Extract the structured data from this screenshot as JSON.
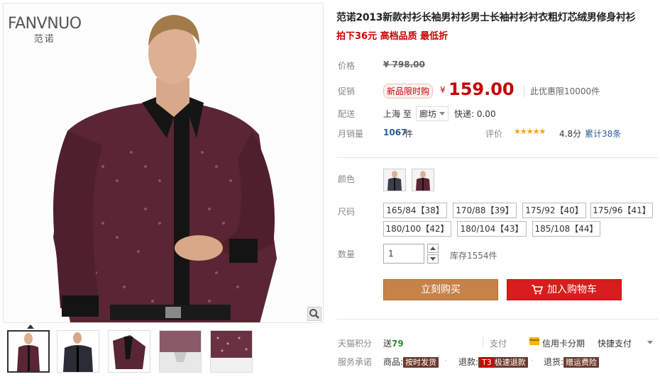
{
  "brand": {
    "logo": "FANVNUO",
    "logo_sub": "范诺"
  },
  "gallery": {
    "zoom_icon": "magnifier-icon",
    "thumb_count": 5
  },
  "product": {
    "title": "范诺2013新款衬衫长袖男衬衫男士长袖衬衫衬衣粗灯芯绒男修身衬衫",
    "subtitle": "拍下36元 高档品质 最低折"
  },
  "price": {
    "orig_label": "价格",
    "orig_value": "¥ 798.00",
    "promo_label": "促销",
    "promo_badge": "新品限时购",
    "promo_yen": "¥",
    "promo_value": "159.00",
    "promo_note": "此优惠限10000件"
  },
  "shipping": {
    "label": "配送",
    "from": "上海 至",
    "to": "廊坊",
    "express": "快递: 0.00"
  },
  "sales": {
    "label": "月销量",
    "value": "1067",
    "unit": "件",
    "rating_label": "评价",
    "stars": "★★★★★",
    "score": "4.8分",
    "reviews": "累计38条"
  },
  "options": {
    "color_label": "颜色",
    "size_label": "尺码",
    "sizes": [
      "165/84【38】",
      "170/88【39】",
      "175/92【40】",
      "175/96【41】",
      "180/100【42】",
      "180/104【43】",
      "185/108【44】"
    ],
    "qty_label": "数量",
    "qty_value": "1",
    "stock": "库存1554件"
  },
  "actions": {
    "buy_now": "立刻购买",
    "add_cart": "加入购物车"
  },
  "footer": {
    "points_label": "天猫积分",
    "points_prefix": "送",
    "points_value": "79",
    "pay_label": "支付",
    "credit": "信用卡分期",
    "quick_pay": "快捷支付",
    "service_label": "服务承诺",
    "svc1_prefix": "商品:",
    "svc1_tag": "按时发货",
    "svc2_prefix": "退款:",
    "svc2_t3": "T3",
    "svc2_tag": "极速退款",
    "svc3_prefix": "退货:",
    "svc3_tag": "赠运费险"
  },
  "colors": {
    "price_red": "#c40000",
    "buy_now_bg": "#c7824a",
    "add_cart_bg": "#d71d1d",
    "link_blue": "#2a5a9b"
  }
}
